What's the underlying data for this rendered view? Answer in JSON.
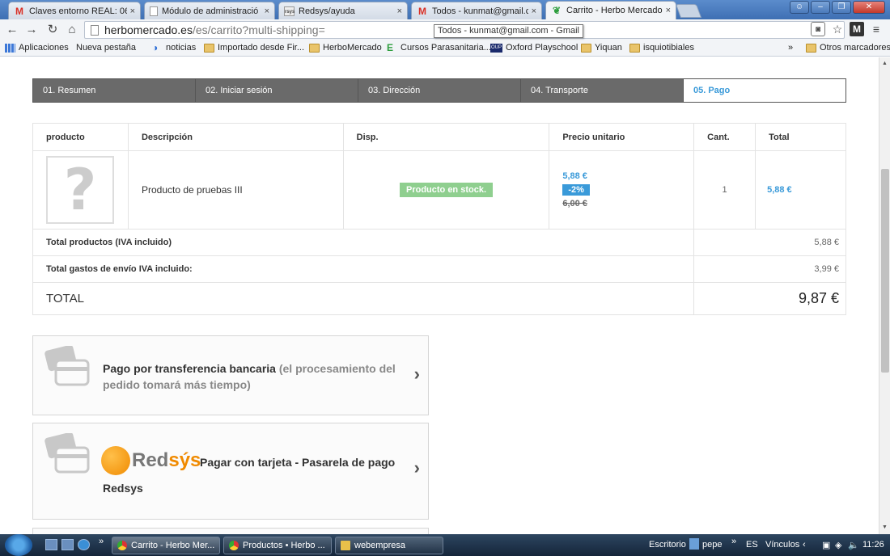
{
  "browser": {
    "tabs": [
      {
        "label": "Claves entorno REAL: 061(",
        "icon": "gmail-icon",
        "active": false
      },
      {
        "label": "Módulo de administració",
        "icon": "page-icon",
        "active": false
      },
      {
        "label": "Redsys/ayuda",
        "icon": "redsys-favicon",
        "active": false
      },
      {
        "label": "Todos - kunmat@gmail.c",
        "icon": "gmail-icon",
        "active": false
      },
      {
        "label": "Carrito - Herbo Mercado",
        "icon": "herbomercado-favicon",
        "active": true
      }
    ],
    "tab_close": "×",
    "url_host": "herbomercado.es",
    "url_path": "/es/carrito?multi-shipping=",
    "tooltip": "Todos - kunmat@gmail.com - Gmail",
    "bookmarks": [
      {
        "label": "Aplicaciones",
        "icon": "apps"
      },
      {
        "label": "Nueva pestaña",
        "icon": "page"
      },
      {
        "label": "noticias",
        "icon": "nt"
      },
      {
        "label": "Importado desde Fir...",
        "icon": "folder"
      },
      {
        "label": "HerboMercado",
        "icon": "folder"
      },
      {
        "label": "Cursos Parasanitaria...",
        "icon": "e"
      },
      {
        "label": "Oxford Playschool",
        "icon": "oup"
      },
      {
        "label": "Yiquan",
        "icon": "folder"
      },
      {
        "label": "isquiotibiales",
        "icon": "folder"
      }
    ],
    "bookmarks_more": "»",
    "other_bookmarks": "Otros marcadores"
  },
  "checkout": {
    "steps": [
      {
        "label": "01. Resumen",
        "active": false
      },
      {
        "label": "02. Iniciar sesión",
        "active": false
      },
      {
        "label": "03. Dirección",
        "active": false
      },
      {
        "label": "04. Transporte",
        "active": false
      },
      {
        "label": "05. Pago",
        "active": true
      }
    ]
  },
  "cart": {
    "headers": [
      "producto",
      "Descripción",
      "Disp.",
      "Precio unitario",
      "Cant.",
      "Total"
    ],
    "item": {
      "image_placeholder": "?",
      "description": "Producto de pruebas III",
      "availability": "Producto en stock.",
      "price_new": "5,88 €",
      "discount": "-2%",
      "price_old": "6,00 €",
      "quantity": "1",
      "line_total": "5,88 €"
    },
    "total_products_label": "Total productos (IVA incluido)",
    "total_products_value": "5,88 €",
    "shipping_label": "Total gastos de envío IVA incluido:",
    "shipping_value": "3,99 €",
    "grand_total_label": "TOTAL",
    "grand_total_value": "9,87 €"
  },
  "payment": {
    "bank_transfer_main": "Pago por transferencia bancaria",
    "bank_transfer_note": "(el procesamiento del pedido tomará más tiempo)",
    "redsys_logo_red": "Red",
    "redsys_logo_sys": "sýs",
    "redsys_label_line1": "Pagar con tarjeta - Pasarela de pago",
    "redsys_label_line2": "Redsys",
    "chevron": "›"
  },
  "taskbar": {
    "overflow": "»",
    "buttons": [
      {
        "label": "Carrito - Herbo Mer...",
        "icon": "chrome"
      },
      {
        "label": "Productos • Herbo ...",
        "icon": "chrome"
      },
      {
        "label": "webempresa",
        "icon": "note"
      }
    ],
    "escritorio": "Escritorio",
    "user": "pepe",
    "lang": "ES",
    "vinculos": "Vínculos",
    "time": "11:26"
  },
  "colors": {
    "accent": "#3a9ad9",
    "stock_green": "#8fcf8f",
    "step_bg": "#6a6a6a",
    "redsys_orange": "#f08a00"
  }
}
